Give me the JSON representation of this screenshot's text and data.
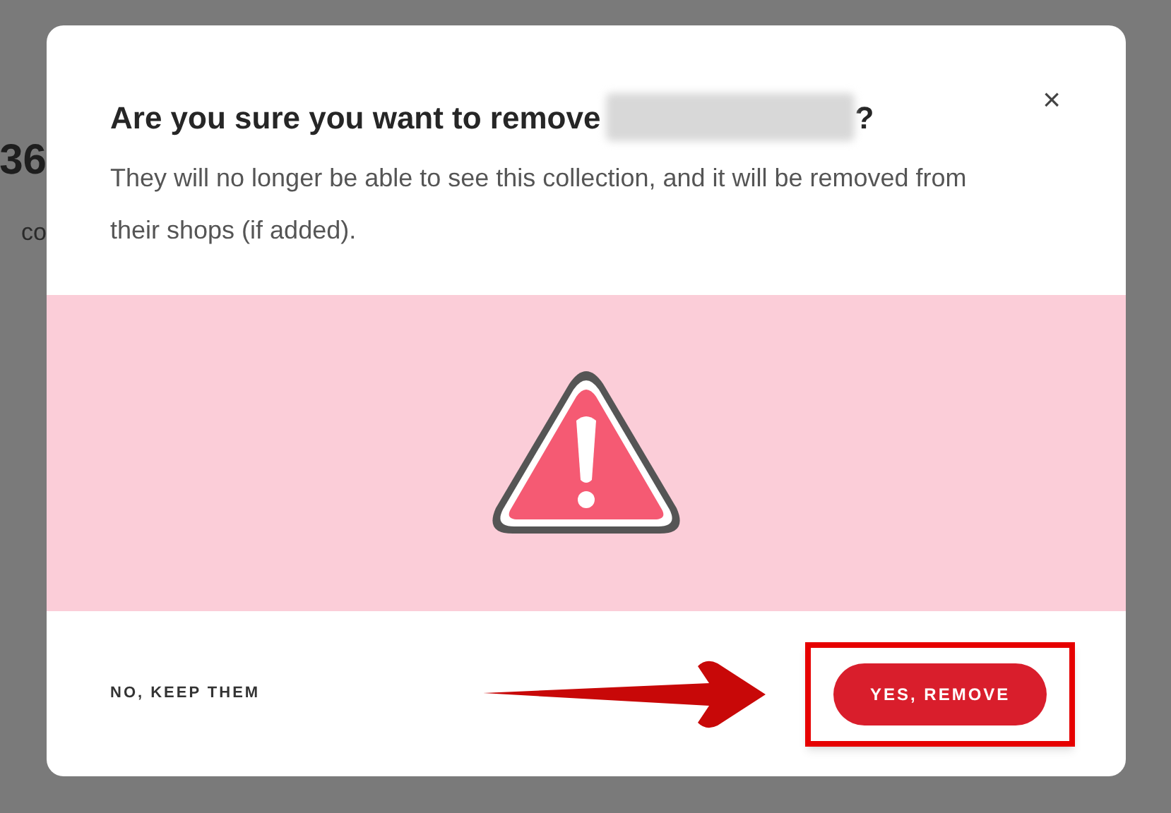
{
  "background": {
    "texts": [
      "36",
      "co"
    ]
  },
  "dialog": {
    "title_before": "Are you sure you want to remove",
    "title_after": "?",
    "name_redacted": true,
    "message": "They will no longer be able to see this collection, and it will be removed from their shops (if added).",
    "close": "×",
    "cancel": "NO, KEEP THEM",
    "confirm": "YES, REMOVE",
    "confirm_highlighted": true
  }
}
